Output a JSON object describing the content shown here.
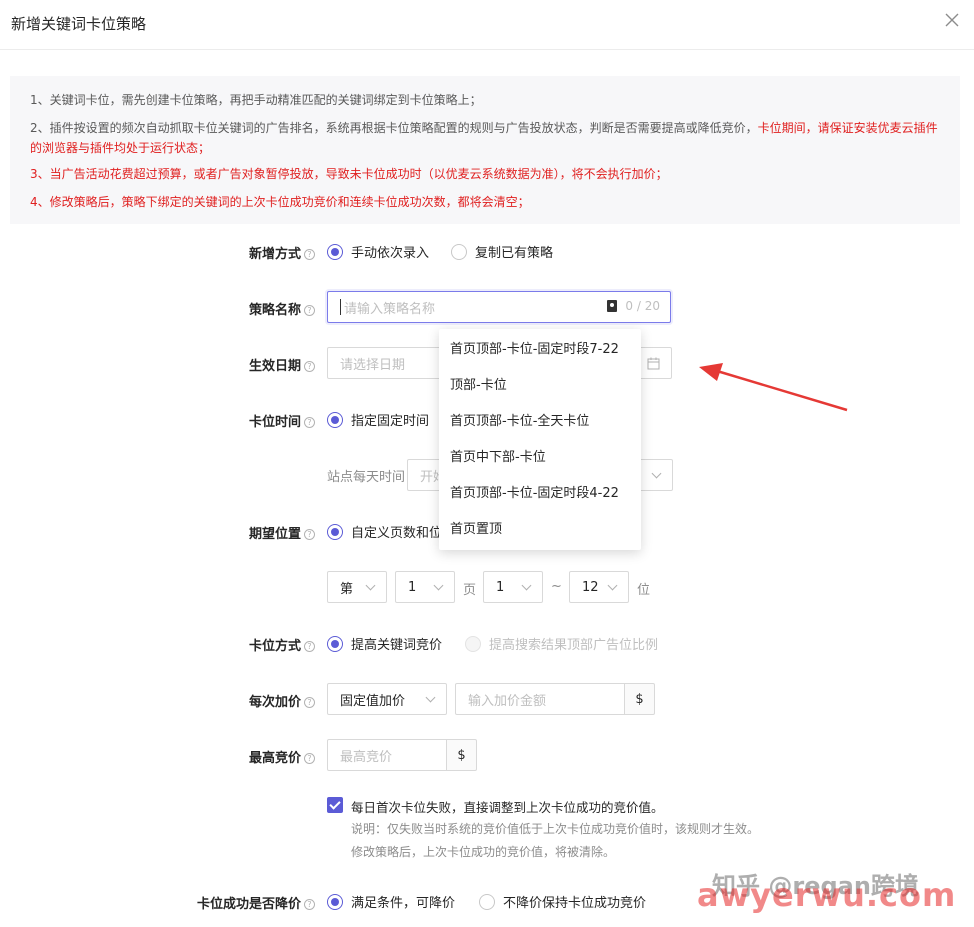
{
  "dialog": {
    "title": "新增关键词卡位策略"
  },
  "notice": {
    "line1": "1、关键词卡位，需先创建卡位策略，再把手动精准匹配的关键词绑定到卡位策略上；",
    "line2_gray": "2、插件按设置的频次自动抓取卡位关键词的广告排名，系统再根据卡位策略配置的规则与广告投放状态，判断是否需要提高或降低竞价，",
    "line2_red": "卡位期间，请保证安装优麦云插件的浏览器与插件均处于运行状态；",
    "line3": "3、当广告活动花费超过预算，或者广告对象暂停投放，导致未卡位成功时（以优麦云系统数据为准），将不会执行加价；",
    "line4": "4、修改策略后，策略下绑定的关键词的上次卡位成功竞价和连续卡位成功次数，都将会清空；"
  },
  "form": {
    "add_method": {
      "label": "新增方式",
      "opt1": "手动依次录入",
      "opt2": "复制已有策略"
    },
    "strategy_name": {
      "label": "策略名称",
      "placeholder": "请输入策略名称",
      "counter": "0 / 20"
    },
    "effective_date": {
      "label": "生效日期",
      "placeholder": "请选择日期"
    },
    "slot_time": {
      "label": "卡位时间",
      "opt1": "指定固定时间",
      "site_label": "站点每天时间",
      "start_placeholder": "开始"
    },
    "expected_position": {
      "label": "期望位置",
      "opt1": "自定义页数和位",
      "prefix": "第",
      "page_value": "1",
      "page_unit": "页",
      "from_value": "1",
      "tilde": "~",
      "to_value": "12",
      "pos_unit": "位"
    },
    "slot_method": {
      "label": "卡位方式",
      "opt1": "提高关键词竞价",
      "opt2": "提高搜索结果顶部广告位比例"
    },
    "increment": {
      "label": "每次加价",
      "select_value": "固定值加价",
      "amount_placeholder": "输入加价金额",
      "currency": "$"
    },
    "max_bid": {
      "label": "最高竞价",
      "placeholder": "最高竞价",
      "currency": "$"
    },
    "checkbox": {
      "label": "每日首次卡位失败，直接调整到上次卡位成功的竞价值。",
      "note1": "说明：仅失败当时系统的竞价值低于上次卡位成功竞价值时，该规则才生效。",
      "note2": "修改策略后，上次卡位成功的竞价值，将被清除。"
    },
    "lower_after_success": {
      "label": "卡位成功是否降价",
      "opt1": "满足条件，可降价",
      "opt2": "不降价保持卡位成功竞价"
    }
  },
  "dropdown": {
    "options": [
      "首页顶部-卡位-固定时段7-22",
      "顶部-卡位",
      "首页顶部-卡位-全天卡位",
      "首页中下部-卡位",
      "首页顶部-卡位-固定时段4-22",
      "首页置顶"
    ]
  },
  "watermark": {
    "line1": "知乎 @regan跨境",
    "line2": "awyerwu.com"
  },
  "colors": {
    "accent": "#5b5bd6",
    "warning": "#e02020",
    "annotation_arrow": "#e53935"
  }
}
